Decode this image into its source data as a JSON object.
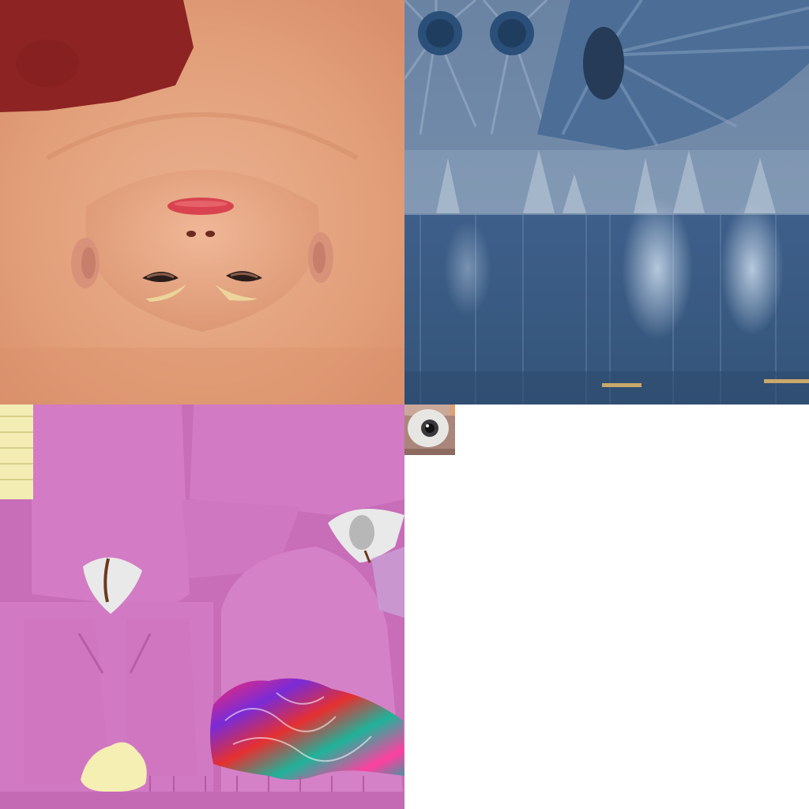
{
  "atlas": {
    "regions": [
      {
        "id": "face",
        "kind": "skin-head-texture"
      },
      {
        "id": "denim",
        "kind": "jeans-texture"
      },
      {
        "id": "shirt",
        "kind": "pink-shirt-texture"
      },
      {
        "id": "eye",
        "kind": "eyeball-texture"
      },
      {
        "id": "empty",
        "kind": "unused-space"
      }
    ]
  },
  "colors": {
    "skin": "#e5a47e",
    "skin_shadow": "#c9855f",
    "hair": "#8e2323",
    "lips": "#d9434f",
    "denim_light": "#6c86a6",
    "denim_dark": "#2f4f78",
    "denim_wash": "#9fb8d2",
    "shirt_pink": "#cd72bd",
    "shirt_pink_dark": "#b95aa8",
    "stripe_cream": "#f3edb4",
    "eye_white": "#e8e6e3",
    "iris": "#3a3a3a",
    "background": "#ffffff"
  }
}
